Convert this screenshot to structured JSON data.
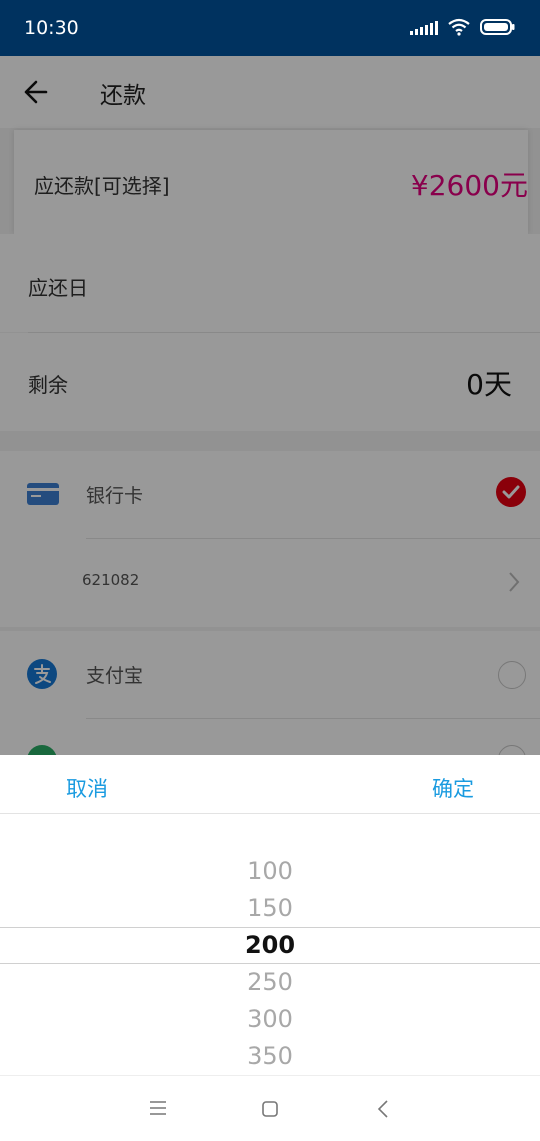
{
  "status_bar": {
    "time": "10:30"
  },
  "header": {
    "title": "还款"
  },
  "repay": {
    "amount_label": "应还款[可选择]",
    "amount_value": "¥2600元",
    "due_label": "应还日",
    "remain_label": "剩余",
    "remain_value": "0天"
  },
  "payment": {
    "bank_card_label": "银行卡",
    "card_number": "621082",
    "alipay_label": "支付宝"
  },
  "picker": {
    "cancel": "取消",
    "confirm": "确定",
    "options": [
      "100",
      "150",
      "200",
      "250",
      "300",
      "350"
    ],
    "selected": "200"
  },
  "colors": {
    "status_bar": "#00325f",
    "accent": "#1a9be0",
    "amount": "#e4007f",
    "check": "#e60012"
  }
}
